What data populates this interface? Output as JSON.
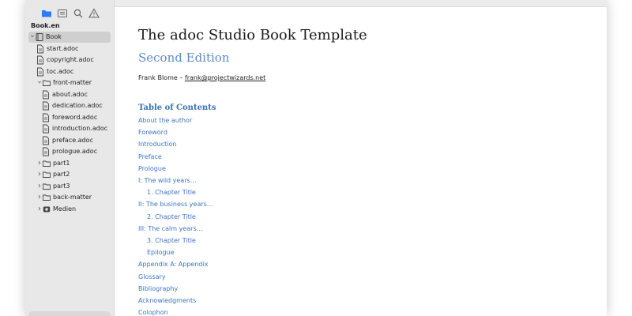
{
  "sidebar": {
    "toolbar_icons": [
      "folder-icon",
      "outline-icon",
      "search-icon",
      "warning-icon"
    ],
    "title": "Book.en",
    "tree": [
      {
        "label": "Book",
        "indent": 0,
        "chevron": "v",
        "icon": "book-icon",
        "selected": true
      },
      {
        "label": "start.adoc",
        "indent": 1,
        "chevron": "",
        "icon": "file-icon",
        "selected": false
      },
      {
        "label": "copyright.adoc",
        "indent": 1,
        "chevron": "",
        "icon": "file-icon",
        "selected": false
      },
      {
        "label": "toc.adoc",
        "indent": 1,
        "chevron": "",
        "icon": "file-icon",
        "selected": false
      },
      {
        "label": "front-matter",
        "indent": 1,
        "chevron": "v",
        "icon": "folder-icon",
        "selected": false
      },
      {
        "label": "about.adoc",
        "indent": 2,
        "chevron": "",
        "icon": "file-icon",
        "selected": false
      },
      {
        "label": "dedication.adoc",
        "indent": 2,
        "chevron": "",
        "icon": "file-icon",
        "selected": false
      },
      {
        "label": "foreword.adoc",
        "indent": 2,
        "chevron": "",
        "icon": "file-icon",
        "selected": false
      },
      {
        "label": "introduction.adoc",
        "indent": 2,
        "chevron": "",
        "icon": "file-icon",
        "selected": false
      },
      {
        "label": "preface.adoc",
        "indent": 2,
        "chevron": "",
        "icon": "file-icon",
        "selected": false
      },
      {
        "label": "prologue.adoc",
        "indent": 2,
        "chevron": "",
        "icon": "file-icon",
        "selected": false
      },
      {
        "label": "part1",
        "indent": 1,
        "chevron": ">",
        "icon": "folder-icon",
        "selected": false
      },
      {
        "label": "part2",
        "indent": 1,
        "chevron": ">",
        "icon": "folder-icon",
        "selected": false
      },
      {
        "label": "part3",
        "indent": 1,
        "chevron": ">",
        "icon": "folder-icon",
        "selected": false
      },
      {
        "label": "back-matter",
        "indent": 1,
        "chevron": ">",
        "icon": "folder-icon",
        "selected": false
      },
      {
        "label": "Medien",
        "indent": 1,
        "chevron": ">",
        "icon": "media-icon",
        "selected": false
      }
    ]
  },
  "document": {
    "title": "The adoc Studio Book Template",
    "subtitle": "Second Edition",
    "author": "Frank Blome",
    "author_sep": " – ",
    "email": "frank@projectwizards.net",
    "toc_title": "Table of Contents",
    "toc": [
      {
        "label": "About the author",
        "level": 0
      },
      {
        "label": "Foreword",
        "level": 0
      },
      {
        "label": "Introduction",
        "level": 0
      },
      {
        "label": "Preface",
        "level": 0
      },
      {
        "label": "Prologue",
        "level": 0
      },
      {
        "label": "I: The wild years…",
        "level": 0
      },
      {
        "label": "1. Chapter Title",
        "level": 1
      },
      {
        "label": "II: The business years…",
        "level": 0
      },
      {
        "label": "2. Chapter Title",
        "level": 1
      },
      {
        "label": "III: The calm years…",
        "level": 0
      },
      {
        "label": "3. Chapter Title",
        "level": 1
      },
      {
        "label": "Epilogue",
        "level": 1
      },
      {
        "label": "Appendix A: Appendix",
        "level": 0
      },
      {
        "label": "Glossary",
        "level": 0
      },
      {
        "label": "Bibliography",
        "level": 0
      },
      {
        "label": "Acknowledgments",
        "level": 0
      },
      {
        "label": "Colophon",
        "level": 0
      }
    ]
  },
  "colors": {
    "accent": "#3f74c4",
    "subtitle": "#5b8ac7",
    "sidebar_bg": "#e8e8e8",
    "folder_icon": "#2f7bf5"
  }
}
